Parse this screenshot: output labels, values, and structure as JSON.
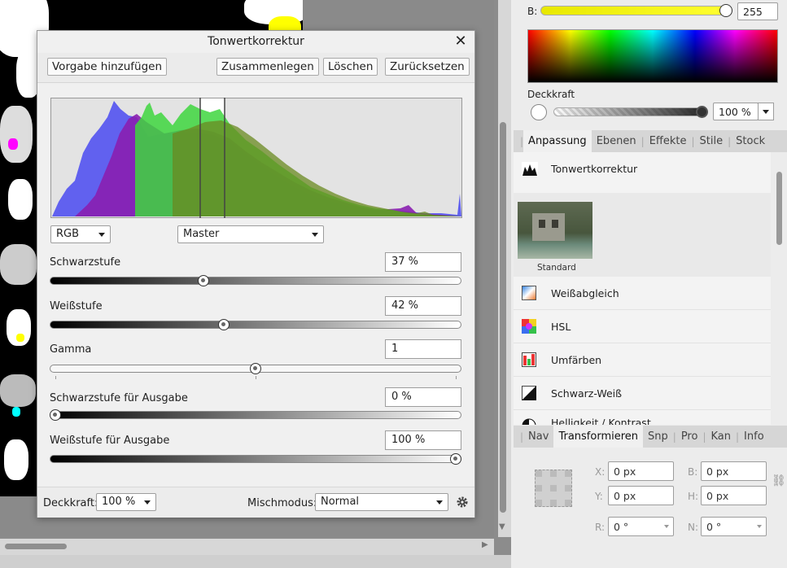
{
  "dialog": {
    "title": "Tonwertkorrektur",
    "buttons": {
      "add_preset": "Vorgabe hinzufügen",
      "merge": "Zusammenlegen",
      "delete": "Löschen",
      "reset": "Zurücksetzen"
    },
    "channel_select": "RGB",
    "mode_select": "Master",
    "sliders": {
      "black_level": {
        "label": "Schwarzstufe",
        "value": "37 %",
        "position": 0.37
      },
      "white_level": {
        "label": "Weißstufe",
        "value": "42 %",
        "position": 0.42
      },
      "gamma": {
        "label": "Gamma",
        "value": "1",
        "position": 0.5
      },
      "output_black": {
        "label": "Schwarzstufe für Ausgabe",
        "value": "0 %",
        "position": 0.0
      },
      "output_white": {
        "label": "Weißstufe für Ausgabe",
        "value": "100 %",
        "position": 1.0
      }
    },
    "footer": {
      "opacity_label": "Deckkraft:",
      "opacity_value": "100 %",
      "blend_label": "Mischmodus:",
      "blend_value": "Normal"
    }
  },
  "color_panel": {
    "b_label": "B:",
    "b_value": "255",
    "b_position": 1.0,
    "opacity_label": "Deckkraft",
    "opacity_value": "100 %",
    "opacity_position": 1.0
  },
  "adjust_tabs": [
    "Anpassung",
    "Ebenen",
    "Effekte",
    "Stile",
    "Stock"
  ],
  "adjust_active": "Anpassung",
  "adjust_header": "Tonwertkorrektur",
  "preset_label": "Standard",
  "adjust_items": [
    "Weißabgleich",
    "HSL",
    "Umfärben",
    "Schwarz-Weiß",
    "Helligkeit / Kontrast"
  ],
  "transform_tabs": [
    "Nav",
    "Transformieren",
    "Snp",
    "Pro",
    "Kan",
    "Info"
  ],
  "transform_active": "Transformieren",
  "transform": {
    "x_label": "X:",
    "x_value": "0 px",
    "y_label": "Y:",
    "y_value": "0 px",
    "w_label": "B:",
    "w_value": "0 px",
    "h_label": "H:",
    "h_value": "0 px",
    "r_label": "R:",
    "r_value": "0 °",
    "s_label": "N:",
    "s_value": "0 °"
  }
}
